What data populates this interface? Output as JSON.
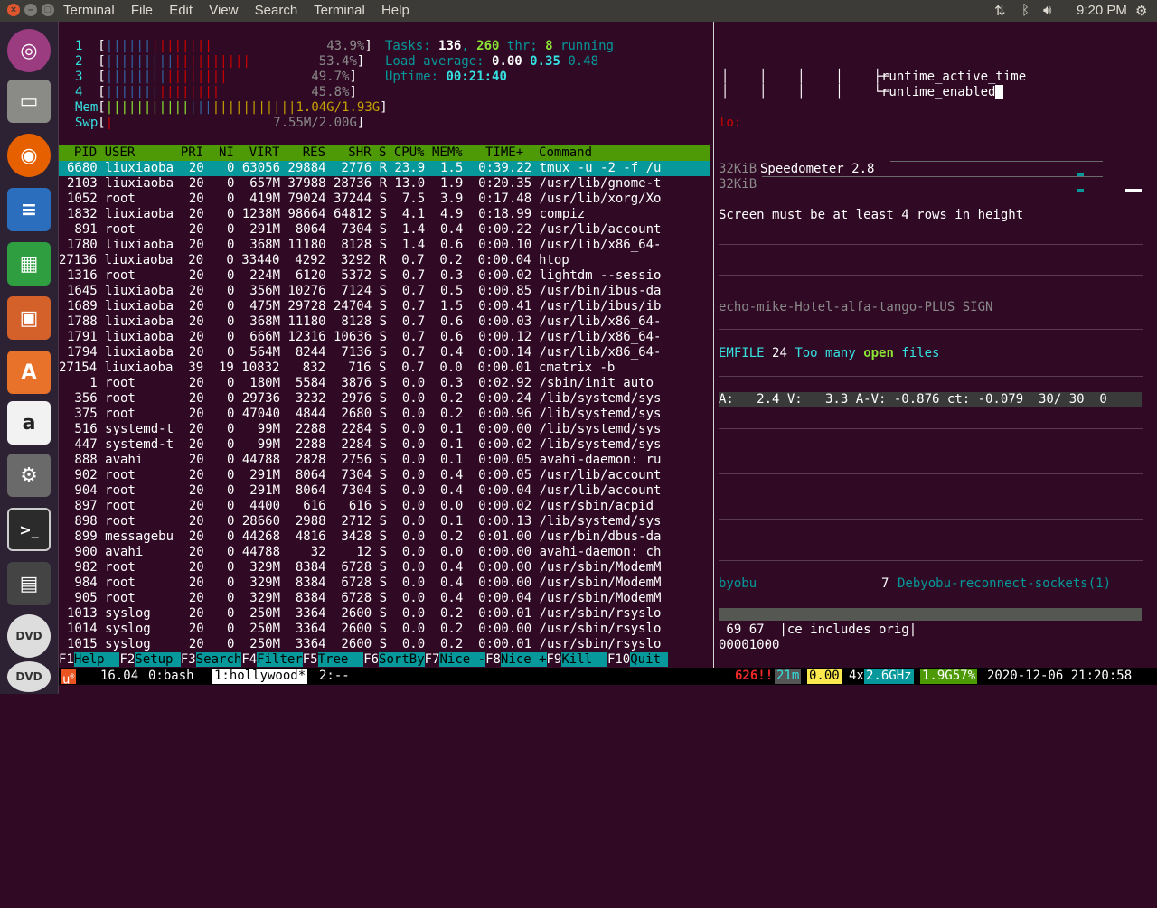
{
  "menubar": {
    "items": [
      "Terminal",
      "File",
      "Edit",
      "View",
      "Search",
      "Terminal",
      "Help"
    ],
    "clock": "9:20 PM",
    "window_buttons": [
      "×",
      "–",
      "□"
    ]
  },
  "launcher": {
    "items": [
      "Ubuntu Dash",
      "Files",
      "Firefox",
      "LibreOffice Writer",
      "LibreOffice Calc",
      "LibreOffice Impress",
      "Ubuntu Software",
      "Amazon",
      "System Settings",
      "Terminal",
      "Save",
      "DVD",
      "DVD"
    ]
  },
  "htop": {
    "cpus": [
      {
        "n": "1",
        "pct": "43.9%"
      },
      {
        "n": "2",
        "pct": "53.4%"
      },
      {
        "n": "3",
        "pct": "49.7%"
      },
      {
        "n": "4",
        "pct": "45.8%"
      }
    ],
    "mem_label": "Mem",
    "mem_value": "1.04G/1.93G",
    "swp_label": "Swp",
    "swp_value": "7.55M/2.00G",
    "tasks_label": "Tasks:",
    "tasks": "136",
    "thr": "260",
    "thr_label": "thr;",
    "running": "8",
    "running_label": "running",
    "load_label": "Load average:",
    "load1": "0.00",
    "load5": "0.35",
    "load15": "0.48",
    "uptime_label": "Uptime:",
    "uptime": "00:21:40",
    "header": "  PID USER      PRI  NI  VIRT   RES   SHR S CPU% MEM%   TIME+  Command",
    "rows": [
      "6680 liuxiaoba  20   0 63056 29884  2776 R 23.9  1.5  0:39.22 tmux -u -2 -f /u",
      "2103 liuxiaoba  20   0  657M 37988 28736 R 13.0  1.9  0:20.35 /usr/lib/gnome-t",
      "1052 root       20   0  419M 79024 37244 S  7.5  3.9  0:17.48 /usr/lib/xorg/Xo",
      "1832 liuxiaoba  20   0 1238M 98664 64812 S  4.1  4.9  0:18.99 compiz",
      " 891 root       20   0  291M  8064  7304 S  1.4  0.4  0:00.22 /usr/lib/account",
      "1780 liuxiaoba  20   0  368M 11180  8128 S  1.4  0.6  0:00.10 /usr/lib/x86_64-",
      "27136 liuxiaoba  20   0 33440  4292  3292 R  0.7  0.2  0:00.04 htop",
      "1316 root       20   0  224M  6120  5372 S  0.7  0.3  0:00.02 lightdm --sessio",
      "1645 liuxiaoba  20   0  356M 10276  7124 S  0.7  0.5  0:00.85 /usr/bin/ibus-da",
      "1689 liuxiaoba  20   0  475M 29728 24704 S  0.7  1.5  0:00.41 /usr/lib/ibus/ib",
      "1788 liuxiaoba  20   0  368M 11180  8128 S  0.7  0.6  0:00.03 /usr/lib/x86_64-",
      "1791 liuxiaoba  20   0  666M 12316 10636 S  0.7  0.6  0:00.12 /usr/lib/x86_64-",
      "1794 liuxiaoba  20   0  564M  8244  7136 S  0.7  0.4  0:00.14 /usr/lib/x86_64-",
      "27154 liuxiaoba  39  19 10832   832   716 S  0.7  0.0  0:00.01 cmatrix -b",
      "   1 root       20   0  180M  5584  3876 S  0.0  0.3  0:02.92 /sbin/init auto",
      " 356 root       20   0 29736  3232  2976 S  0.0  0.2  0:00.24 /lib/systemd/sys",
      " 375 root       20   0 47040  4844  2680 S  0.0  0.2  0:00.96 /lib/systemd/sys",
      " 516 systemd-t  20   0   99M  2288  2284 S  0.0  0.1  0:00.00 /lib/systemd/sys",
      " 447 systemd-t  20   0   99M  2288  2284 S  0.0  0.1  0:00.02 /lib/systemd/sys",
      " 888 avahi      20   0 44788  2828  2756 S  0.0  0.1  0:00.05 avahi-daemon: ru",
      " 902 root       20   0  291M  8064  7304 S  0.0  0.4  0:00.05 /usr/lib/account",
      " 904 root       20   0  291M  8064  7304 S  0.0  0.4  0:00.04 /usr/lib/account",
      " 897 root       20   0  4400   616   616 S  0.0  0.0  0:00.02 /usr/sbin/acpid",
      " 898 root       20   0 28660  2988  2712 S  0.0  0.1  0:00.13 /lib/systemd/sys",
      " 899 messagebu  20   0 44268  4816  3428 S  0.0  0.2  0:01.00 /usr/bin/dbus-da",
      " 900 avahi      20   0 44788    32    12 S  0.0  0.0  0:00.00 avahi-daemon: ch",
      " 982 root       20   0  329M  8384  6728 S  0.0  0.4  0:00.00 /usr/sbin/ModemM",
      " 984 root       20   0  329M  8384  6728 S  0.0  0.4  0:00.00 /usr/sbin/ModemM",
      " 905 root       20   0  329M  8384  6728 S  0.0  0.4  0:00.04 /usr/sbin/ModemM",
      "1013 syslog     20   0  250M  3364  2600 S  0.0  0.2  0:00.01 /usr/sbin/rsyslo",
      "1014 syslog     20   0  250M  3364  2600 S  0.0  0.2  0:00.00 /usr/sbin/rsyslo",
      "1015 syslog     20   0  250M  3364  2600 S  0.0  0.2  0:00.01 /usr/sbin/rsyslo"
    ],
    "fkeys": [
      {
        "k": "F1",
        "l": "Help  "
      },
      {
        "k": "F2",
        "l": "Setup "
      },
      {
        "k": "F3",
        "l": "Search"
      },
      {
        "k": "F4",
        "l": "Filter"
      },
      {
        "k": "F5",
        "l": "Tree  "
      },
      {
        "k": "F6",
        "l": "SortBy"
      },
      {
        "k": "F7",
        "l": "Nice -"
      },
      {
        "k": "F8",
        "l": "Nice +"
      },
      {
        "k": "F9",
        "l": "Kill  "
      },
      {
        "k": "F10",
        "l": "Quit "
      }
    ]
  },
  "right": {
    "tree1": "runtime_active_time",
    "tree2": "runtime_enabled",
    "lo": "lo:",
    "kib1": "32KiB",
    "speedo": "Speedometer 2.8",
    "kib2": "32KiB",
    "screen_msg": "Screen must be at least 4 rows in height",
    "echo": "echo-mike-Hotel-alfa-tango-PLUS_SIGN",
    "emfile_a": "EMFILE",
    "emfile_b": "24",
    "emfile_c": "Too many",
    "emfile_d": "open",
    "emfile_e": "files",
    "av": "A:   2.4 V:   3.3 A-V: -0.876 ct: -0.079  30/ 30  0",
    "byobu": "byobu",
    "byobu_n": "7",
    "byobu_msg": "Debyobu-reconnect-sockets(1)",
    "hex1": " 69 67  |ce includes orig|",
    "hex2": "00001000"
  },
  "status": {
    "u": "u",
    "ver": "16.04",
    "win0": "0:bash",
    "win1": "1:hollywood*",
    "win2": "2:--",
    "alert": "626!!",
    "mins": "21m",
    "load": "0.00",
    "cpu_n": "4x",
    "ghz": "2.6GHz",
    "mem": "1.9G57%",
    "datetime": "2020-12-06 21:20:58"
  }
}
